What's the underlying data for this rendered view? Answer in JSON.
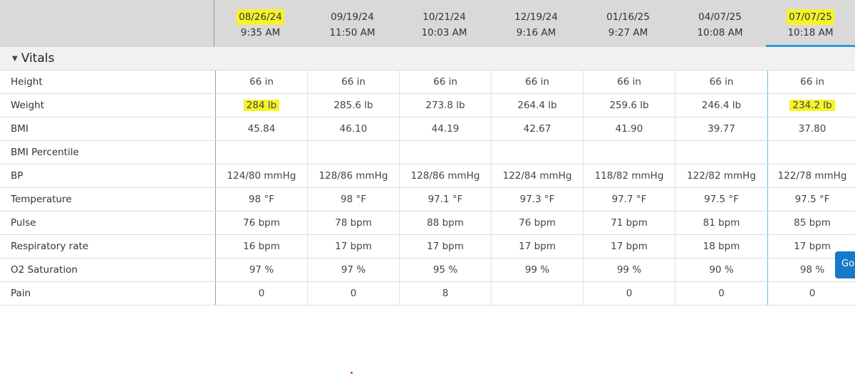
{
  "colors": {
    "highlight": "#f6f32a",
    "header_bg": "#d9d9d9",
    "selected_underline": "#2e9ad8",
    "button_bg": "#1679c9"
  },
  "header": {
    "columns": [
      {
        "date": "08/26/24",
        "time": "9:35 AM",
        "highlighted": true
      },
      {
        "date": "09/19/24",
        "time": "11:50 AM"
      },
      {
        "date": "10/21/24",
        "time": "10:03 AM"
      },
      {
        "date": "12/19/24",
        "time": "9:16 AM"
      },
      {
        "date": "01/16/25",
        "time": "9:27 AM"
      },
      {
        "date": "04/07/25",
        "time": "10:08 AM"
      },
      {
        "date": "07/07/25",
        "time": "10:18 AM",
        "highlighted": true,
        "selected": true
      }
    ]
  },
  "section": {
    "title": "Vitals",
    "icon": "triangle-down-icon"
  },
  "rows": [
    {
      "label": "Height",
      "values": [
        "66 in",
        "66 in",
        "66 in",
        "66 in",
        "66 in",
        "66 in",
        "66 in"
      ]
    },
    {
      "label": "Weight",
      "values": [
        "284 lb",
        "285.6 lb",
        "273.8 lb",
        "264.4 lb",
        "259.6 lb",
        "246.4 lb",
        "234.2 lb"
      ]
    },
    {
      "label": "BMI",
      "values": [
        "45.84",
        "46.10",
        "44.19",
        "42.67",
        "41.90",
        "39.77",
        "37.80"
      ]
    },
    {
      "label": "BMI Percentile",
      "values": [
        "",
        "",
        "",
        "",
        "",
        "",
        ""
      ]
    },
    {
      "label": "BP",
      "values": [
        "124/80 mmHg",
        "128/86 mmHg",
        "128/86 mmHg",
        "122/84 mmHg",
        "118/82 mmHg",
        "122/82 mmHg",
        "122/78 mmHg"
      ]
    },
    {
      "label": "Temperature",
      "values": [
        "98 °F",
        "98 °F",
        "97.1 °F",
        "97.3 °F",
        "97.7 °F",
        "97.5 °F",
        "97.5 °F"
      ]
    },
    {
      "label": "Pulse",
      "values": [
        "76 bpm",
        "78 bpm",
        "88 bpm",
        "76 bpm",
        "71 bpm",
        "81 bpm",
        "85 bpm"
      ]
    },
    {
      "label": "Respiratory rate",
      "values": [
        "16 bpm",
        "17 bpm",
        "17 bpm",
        "17 bpm",
        "17 bpm",
        "18 bpm",
        "17 bpm"
      ]
    },
    {
      "label": "O2 Saturation",
      "values": [
        "97 %",
        "97 %",
        "95 %",
        "99 %",
        "99 %",
        "90 %",
        "98 %"
      ]
    },
    {
      "label": "Pain",
      "values": [
        "0",
        "0",
        "8",
        "",
        "0",
        "0",
        "0"
      ]
    }
  ],
  "highlighted_cells": {
    "Weight": [
      0,
      6
    ]
  },
  "goto_button": {
    "label": "Go"
  }
}
